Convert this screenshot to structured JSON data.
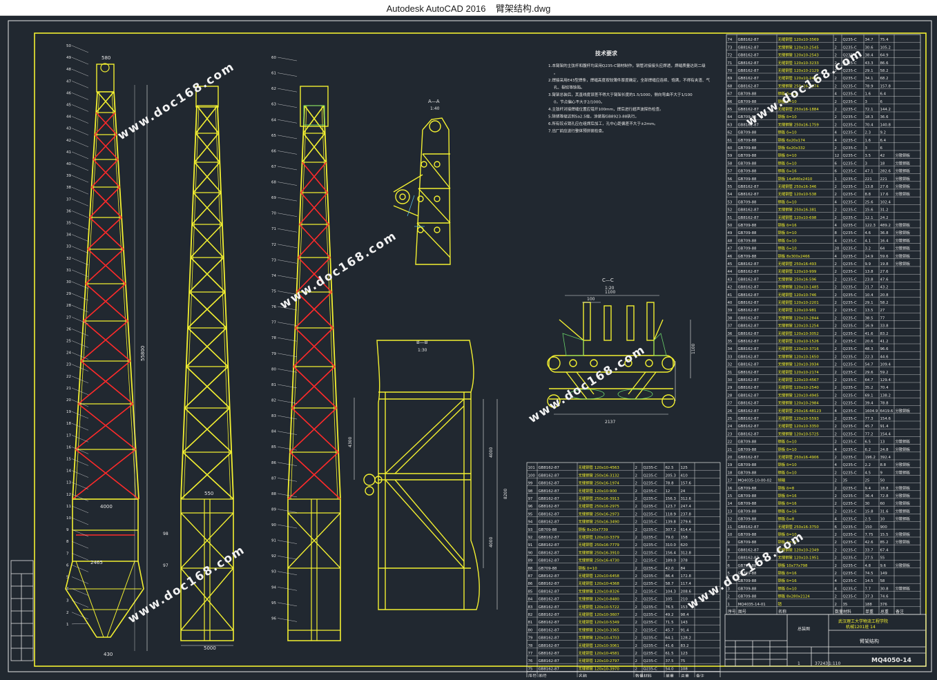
{
  "window": {
    "app": "Autodesk AutoCAD 2016",
    "file": "臂架结构.dwg"
  },
  "colors": {
    "frame": "#f3f030",
    "truss_red": "#ff2a2a",
    "dim": "#e8e8e8",
    "text_green": "#6ad36a",
    "text_cyan": "#5cc8f0",
    "bg": "#212830"
  },
  "tech": {
    "title": "技术要求",
    "items": [
      "1.本臂架的主弦杆和腹杆均采用Q235-C钢材制作，钢管对接接头应焊透，焊缝质量达到二级。",
      "2.焊接采用E43型焊条，焊缝高度按较薄件厚度确定，全部焊缝应连续、饱满，不得有夹渣、气孔、裂纹等缺陷。",
      "3.臂架总装后，其直线度误差不得大于臂架长度的1.5/1000，侧向弯曲不大于1/1000，节点偏心不大于2/1000。",
      "4.主弦杆对接焊缝位置应错开100mm，焊后进行超声波探伤检查。",
      "5.除锈等级达到Sa2.5级，涂装按GB8923-88执行。",
      "6.所有铰点销孔应在组焊后加工，孔中心距偏差不大于±2mm。",
      "7.出厂前应进行整体预拼装检查。"
    ]
  },
  "section_labels": {
    "aa": "A—A",
    "aa_scale": "1:40",
    "bb": "B—B",
    "bb_scale": "1:30",
    "cc": "C—C",
    "cc_scale": "1:20"
  },
  "dims": {
    "total": "55800",
    "w580": "580",
    "w4000": "4000",
    "w2465": "2465",
    "w5000": "5000",
    "w430": "430",
    "w550": "550",
    "w1100": "1100",
    "w100": "100",
    "w2137": "2137",
    "h1100": "1100",
    "h4300": "4300",
    "h4000": "4000",
    "h8200": "8200",
    "h4000b": "4000"
  },
  "upper_parts": {
    "headers": [
      "序号",
      "图号",
      "名称",
      "数量",
      "材料",
      "单重",
      "总重",
      "备注"
    ],
    "rows": [
      [
        "74",
        "GB8162-87",
        "无缝钢管 120x10-3569",
        "2",
        "Q235-C",
        "34.7",
        "75.4",
        ""
      ],
      [
        "73",
        "GB8162-87",
        "无缝钢管 120x10-2545",
        "2",
        "Q235-C",
        "30.6",
        "105.2",
        ""
      ],
      [
        "72",
        "GB8162-87",
        "无缝钢管 120x10-2543",
        "2",
        "Q235-C",
        "38.4",
        "64.9",
        ""
      ],
      [
        "71",
        "GB8162-87",
        "无缝钢管 120x10-3233",
        "2",
        "Q235-C",
        "43.3",
        "86.6",
        ""
      ],
      [
        "70",
        "GB8162-87",
        "无缝钢管 120x10-2129",
        "2",
        "Q235-C",
        "29.1",
        "58.2",
        ""
      ],
      [
        "69",
        "GB8162-87",
        "无缝钢管 120x10-2460",
        "2",
        "Q235-C",
        "34.1",
        "68.2",
        ""
      ],
      [
        "68",
        "GB8162-87",
        "无缝钢管 250x16-1974",
        "2",
        "Q235-C",
        "78.9",
        "157.8",
        ""
      ],
      [
        "67",
        "GB709-88",
        "钢板 δ=12",
        "4",
        "Q235-C",
        "1.6",
        "6.4",
        ""
      ],
      [
        "66",
        "GB709-88",
        "钢板 δ=10",
        "2",
        "Q235-C",
        "3",
        "6",
        ""
      ],
      [
        "65",
        "GB8162-87",
        "无缝钢管 250x16-1884",
        "2",
        "Q235-C",
        "72.1",
        "144.2",
        ""
      ],
      [
        "64",
        "GB709-88",
        "钢板 δ=10",
        "2",
        "Q235-C",
        "18.3",
        "36.6",
        ""
      ],
      [
        "63",
        "GB8162-87",
        "无缝钢管 250x16-1759",
        "2",
        "Q235-C",
        "70.4",
        "140.8",
        ""
      ],
      [
        "62",
        "GB709-88",
        "钢板 δ=10",
        "4",
        "Q235-C",
        "2.3",
        "9.2",
        ""
      ],
      [
        "61",
        "GB709-88",
        "钢板 6x20x174",
        "4",
        "Q235-C",
        "1.6",
        "6.4",
        ""
      ],
      [
        "60",
        "GB709-88",
        "钢板 6x20x332",
        "2",
        "Q235-C",
        "3",
        "6",
        ""
      ],
      [
        "59",
        "GB709-88",
        "钢板 δ=10",
        "12",
        "Q235-C",
        "3.5",
        "42",
        "分散钢板"
      ],
      [
        "58",
        "GB709-88",
        "钢板 δ=10",
        "6",
        "Q235-C",
        "3",
        "18",
        "分散钢板"
      ],
      [
        "57",
        "GB709-88",
        "钢板 δ=16",
        "6",
        "Q235-C",
        "47.1",
        "282.6",
        "分散钢板"
      ],
      [
        "56",
        "GB709-88",
        "钢板 14x840x2410",
        "1",
        "Q235-C",
        "221",
        "221",
        "分散钢板"
      ],
      [
        "55",
        "GB8162-87",
        "无缝钢管 250x16-346",
        "2",
        "Q235-C",
        "13.8",
        "27.6",
        "分散钢板"
      ],
      [
        "54",
        "GB8162-87",
        "无缝钢管 120x10-538",
        "2",
        "Q235-C",
        "8.8",
        "17.6",
        "分散钢板"
      ],
      [
        "53",
        "GB709-88",
        "钢板 δ=10",
        "4",
        "Q235-C",
        "25.6",
        "102.4",
        ""
      ],
      [
        "52",
        "GB8162-87",
        "无缝钢管 250x16-381",
        "2",
        "Q235-C",
        "15.6",
        "31.2",
        ""
      ],
      [
        "51",
        "GB8162-87",
        "无缝钢管 120x10-698",
        "2",
        "Q235-C",
        "12.1",
        "24.2",
        ""
      ],
      [
        "50",
        "GB709-88",
        "钢板 δ=16",
        "4",
        "Q235-C",
        "122.3",
        "489.2",
        "分散钢板"
      ],
      [
        "49",
        "GB709-88",
        "钢板 δ=10",
        "8",
        "Q235-C",
        "4.6",
        "36.8",
        "分散钢板"
      ],
      [
        "48",
        "GB709-88",
        "钢板 δ=10",
        "4",
        "Q235-C",
        "4.1",
        "16.4",
        "分散钢板"
      ],
      [
        "47",
        "GB709-88",
        "钢板 δ=10",
        "20",
        "Q235-C",
        "3.2",
        "64",
        "分散钢板"
      ],
      [
        "46",
        "GB709-88",
        "钢板 8x300x2466",
        "4",
        "Q235-C",
        "14.9",
        "59.6",
        "分散钢板"
      ],
      [
        "45",
        "GB8162-87",
        "无缝钢管 250x16-493",
        "2",
        "Q235-C",
        "9.9",
        "19.8",
        "分散钢板"
      ],
      [
        "44",
        "GB8162-87",
        "无缝钢管 120x10-999",
        "2",
        "Q235-C",
        "13.8",
        "27.6",
        ""
      ],
      [
        "43",
        "GB8162-87",
        "无缝钢管 250x16-596",
        "2",
        "Q235-C",
        "23.8",
        "47.6",
        ""
      ],
      [
        "42",
        "GB8162-87",
        "无缝钢管 120x10-1485",
        "2",
        "Q235-C",
        "21.7",
        "43.2",
        ""
      ],
      [
        "41",
        "GB8162-87",
        "无缝钢管 120x10-746",
        "2",
        "Q235-C",
        "10.4",
        "20.8",
        ""
      ],
      [
        "40",
        "GB8162-87",
        "无缝钢管 120x10-2201",
        "2",
        "Q235-C",
        "29.1",
        "58.2",
        ""
      ],
      [
        "39",
        "GB8162-87",
        "无缝钢管 120x10-981",
        "2",
        "Q235-C",
        "13.5",
        "27",
        ""
      ],
      [
        "38",
        "GB8162-87",
        "无缝钢管 120x10-2844",
        "2",
        "Q235-C",
        "38.5",
        "77",
        ""
      ],
      [
        "37",
        "GB8162-87",
        "无缝钢管 120x10-1254",
        "2",
        "Q235-C",
        "16.9",
        "33.8",
        ""
      ],
      [
        "36",
        "GB8162-87",
        "无缝钢管 120x10-3052",
        "2",
        "Q235-C",
        "41.6",
        "83.2",
        ""
      ],
      [
        "35",
        "GB8162-87",
        "无缝钢管 120x10-1526",
        "2",
        "Q235-C",
        "20.6",
        "41.2",
        ""
      ],
      [
        "34",
        "GB8162-87",
        "无缝钢管 120x10-3716",
        "2",
        "Q235-C",
        "48.3",
        "96.6",
        ""
      ],
      [
        "33",
        "GB8162-87",
        "无缝钢管 120x10-1650",
        "2",
        "Q235-C",
        "22.3",
        "44.6",
        ""
      ],
      [
        "32",
        "GB8162-87",
        "无缝钢管 120x10-3934",
        "2",
        "Q235-C",
        "54.7",
        "109.4",
        ""
      ],
      [
        "31",
        "GB8162-87",
        "无缝钢管 120x10-2174",
        "2",
        "Q235-C",
        "29.6",
        "59.2",
        ""
      ],
      [
        "30",
        "GB8162-87",
        "无缝钢管 120x10-4567",
        "2",
        "Q235-C",
        "64.7",
        "129.4",
        ""
      ],
      [
        "29",
        "GB8162-87",
        "无缝钢管 120x10-2540",
        "2",
        "Q235-C",
        "35.2",
        "70.4",
        ""
      ],
      [
        "28",
        "GB8162-87",
        "无缝钢管 120x10-4945",
        "2",
        "Q235-C",
        "69.1",
        "138.2",
        ""
      ],
      [
        "27",
        "GB8162-87",
        "无缝钢管 120x10-2984",
        "2",
        "Q235-C",
        "39.4",
        "78.8",
        ""
      ],
      [
        "26",
        "GB8162-87",
        "无缝钢管 250x16-48123",
        "4",
        "Q235-C",
        "1604.9",
        "6419.6",
        "分散钢板"
      ],
      [
        "25",
        "GB8162-87",
        "无缝钢管 120x10-5593",
        "2",
        "Q235-C",
        "77.3",
        "154.6",
        ""
      ],
      [
        "24",
        "GB8162-87",
        "无缝钢管 120x10-3350",
        "2",
        "Q235-C",
        "45.7",
        "91.4",
        ""
      ],
      [
        "23",
        "GB8162-87",
        "无缝钢管 120x10-5725",
        "2",
        "Q235-C",
        "77.2",
        "154.4",
        ""
      ],
      [
        "22",
        "GB709-88",
        "钢板 δ=10",
        "2",
        "Q235-C",
        "6.5",
        "13",
        "分散钢板"
      ],
      [
        "21",
        "GB709-88",
        "钢板 δ=10",
        "4",
        "Q235-C",
        "6.2",
        "24.8",
        "分散钢板"
      ],
      [
        "20",
        "GB8162-87",
        "无缝钢管 250x16-4906",
        "2",
        "Q235-C",
        "196.2",
        "392.4",
        ""
      ],
      [
        "19",
        "GB709-88",
        "钢板 δ=10",
        "4",
        "Q235-C",
        "2.2",
        "8.8",
        "分散钢板"
      ],
      [
        "18",
        "GB709-88",
        "钢板 δ=10",
        "2",
        "Q235-C",
        "4.5",
        "9",
        "分散钢板"
      ],
      [
        "17",
        "MQ4035-10-00-02",
        "销轴",
        "2",
        "35",
        "25",
        "50",
        ""
      ],
      [
        "16",
        "GB709-88",
        "钢板 δ=8",
        "2",
        "Q235-C",
        "9.4",
        "18.8",
        "分散钢板"
      ],
      [
        "15",
        "GB709-88",
        "钢板 δ=16",
        "2",
        "Q235-C",
        "36.4",
        "72.8",
        "分散钢板"
      ],
      [
        "14",
        "GB709-88",
        "钢板 δ=16",
        "2",
        "Q235-C",
        "30",
        "60",
        "分散钢板"
      ],
      [
        "13",
        "GB709-88",
        "钢板 δ=16",
        "2",
        "Q235-C",
        "15.8",
        "31.6",
        "分散钢板"
      ],
      [
        "12",
        "GB709-88",
        "钢板 δ=8",
        "4",
        "Q235-C",
        "2.5",
        "10",
        "分散钢板"
      ],
      [
        "11",
        "GB8162-87",
        "无缝钢管 250x16-3750",
        "6",
        "Q235-C",
        "150",
        "900",
        ""
      ],
      [
        "10",
        "GB709-88",
        "钢板 δ=10",
        "2",
        "Q235-C",
        "7.75",
        "15.5",
        "分散钢板"
      ],
      [
        "9",
        "GB709-88",
        "钢板 δ=10",
        "2",
        "Q235-C",
        "42.6",
        "85.2",
        "分散钢板"
      ],
      [
        "8",
        "GB8162-87",
        "无缝钢管 120x10-2349",
        "2",
        "Q235-C",
        "33.7",
        "67.4",
        ""
      ],
      [
        "7",
        "GB8162-87",
        "无缝钢管 120x10-1951",
        "2",
        "Q235-C",
        "27.5",
        "55",
        ""
      ],
      [
        "6",
        "GB709-88",
        "钢板 10x77x798",
        "2",
        "Q235-C",
        "4.8",
        "9.6",
        "分散钢板"
      ],
      [
        "5",
        "GB709-88",
        "钢板 δ=16",
        "2",
        "Q235-C",
        "74.5",
        "149",
        ""
      ],
      [
        "4",
        "GB709-88",
        "钢板 δ=16",
        "4",
        "Q235-C",
        "14.5",
        "58",
        ""
      ],
      [
        "3",
        "GB709-88",
        "钢板 δ=10",
        "4",
        "Q235-C",
        "7.7",
        "30.8",
        "分散钢板"
      ],
      [
        "2",
        "GB709-88",
        "钢板 8x280x2124",
        "2",
        "Q235-C",
        "37.3",
        "74.6",
        ""
      ],
      [
        "1",
        "MQ4035-14-01",
        "销",
        "2",
        "35",
        "188",
        "376",
        ""
      ]
    ]
  },
  "lower_parts": {
    "rows": [
      [
        "101",
        "GB8162-87",
        "无缝钢管 120x10-4563",
        "2",
        "Q235-C",
        "62.5",
        "125"
      ],
      [
        "100",
        "GB8162-87",
        "无缝钢管 250x16-3132",
        "2",
        "Q235-C",
        "205.3",
        "410"
      ],
      [
        "99",
        "GB8162-87",
        "无缝钢管 250x16-1974",
        "2",
        "Q235-C",
        "78.8",
        "157.6"
      ],
      [
        "98",
        "GB8162-87",
        "无缝钢管 120x10-900",
        "2",
        "Q235-C",
        "12",
        "24"
      ],
      [
        "97",
        "GB8162-87",
        "无缝钢管 250x16-3913",
        "2",
        "Q235-C",
        "156.3",
        "312.6"
      ],
      [
        "96",
        "GB8162-87",
        "无缝钢管 250x16-2975",
        "2",
        "Q235-C",
        "123.7",
        "247.4"
      ],
      [
        "95",
        "GB8162-87",
        "无缝钢管 250x16-2973",
        "2",
        "Q235-C",
        "118.9",
        "237.8"
      ],
      [
        "94",
        "GB8162-87",
        "无缝钢管 250x16-3490",
        "2",
        "Q235-C",
        "139.8",
        "279.6"
      ],
      [
        "93",
        "GB709-88",
        "钢板 8x20x7739",
        "2",
        "Q235-C",
        "307.2",
        "614.4"
      ],
      [
        "92",
        "GB8162-87",
        "无缝钢管 120x10-3379",
        "2",
        "Q235-C",
        "79.0",
        "158"
      ],
      [
        "91",
        "GB8162-87",
        "无缝钢管 250x16-7779",
        "2",
        "Q235-C",
        "310.0",
        "620"
      ],
      [
        "90",
        "GB8162-87",
        "无缝钢管 250x16-3910",
        "2",
        "Q235-C",
        "156.4",
        "312.8"
      ],
      [
        "89",
        "GB8162-87",
        "无缝钢管 250x16-4730",
        "2",
        "Q235-C",
        "189.0",
        "378"
      ],
      [
        "88",
        "GB709-88",
        "钢板 δ=10",
        "2",
        "Q235-C",
        "42.0",
        "84"
      ],
      [
        "87",
        "GB8162-87",
        "无缝钢管 120x10-6458",
        "2",
        "Q235-C",
        "86.4",
        "172.8"
      ],
      [
        "86",
        "GB8162-87",
        "无缝钢管 120x10-4368",
        "2",
        "Q235-C",
        "58.7",
        "117.4"
      ],
      [
        "85",
        "GB8162-87",
        "无缝钢管 120x10-8326",
        "2",
        "Q235-C",
        "104.3",
        "208.6"
      ],
      [
        "84",
        "GB8162-87",
        "无缝钢管 120x10-8480",
        "2",
        "Q235-C",
        "105",
        "210"
      ],
      [
        "83",
        "GB8162-87",
        "无缝钢管 120x10-5722",
        "2",
        "Q235-C",
        "76.5",
        "153"
      ],
      [
        "82",
        "GB8162-87",
        "无缝钢管 120x10-3607",
        "2",
        "Q235-C",
        "49.2",
        "98.4"
      ],
      [
        "81",
        "GB8162-87",
        "无缝钢管 120x10-5349",
        "2",
        "Q235-C",
        "71.5",
        "143"
      ],
      [
        "80",
        "GB8162-87",
        "无缝钢管 120x10-3365",
        "2",
        "Q235-C",
        "45.7",
        "91.4"
      ],
      [
        "79",
        "GB8162-87",
        "无缝钢管 120x10-4703",
        "2",
        "Q235-C",
        "64.1",
        "128.2"
      ],
      [
        "78",
        "GB8162-87",
        "无缝钢管 120x10-3061",
        "2",
        "Q235-C",
        "41.6",
        "83.2"
      ],
      [
        "77",
        "GB8162-87",
        "无缝钢管 120x10-4581",
        "2",
        "Q235-C",
        "61.5",
        "123"
      ],
      [
        "76",
        "GB8162-87",
        "无缝钢管 120x10-2797",
        "2",
        "Q235-C",
        "37.5",
        "75"
      ],
      [
        "75",
        "GB8162-87",
        "无缝钢管 120x10-3970",
        "2",
        "Q235-C",
        "54.0",
        "108"
      ]
    ],
    "headers": [
      "序号",
      "图号",
      "名称",
      "数量",
      "材料",
      "单重",
      "总重",
      "备注"
    ],
    "note_93": "100x20x45°"
  },
  "titleblock": {
    "school": "武汉理工大学物流工程学院",
    "class": "机械1201班 14",
    "drawing_name": "臂架结构",
    "drawing_no": "MQ4050-14",
    "weight": "37243",
    "scale": "1:110",
    "sheet": "1",
    "assembly": "总装图"
  },
  "watermark": "www.doc168.com"
}
